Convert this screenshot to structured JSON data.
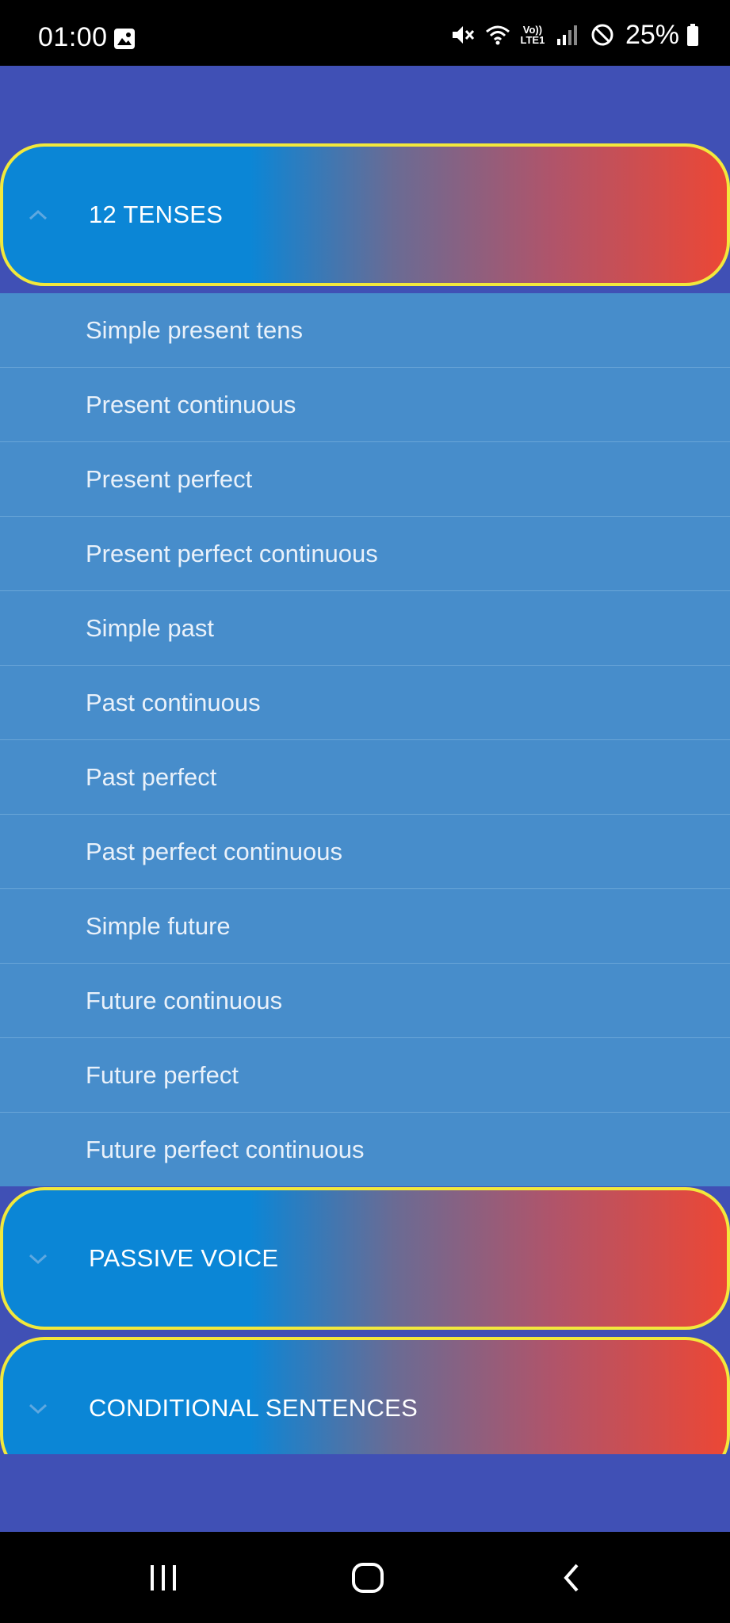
{
  "status_bar": {
    "time": "01:00",
    "volte_line1": "Vo))",
    "volte_line2": "LTE1",
    "battery": "25%"
  },
  "accordion": {
    "groups": [
      {
        "title": "12 TENSES",
        "expanded": true,
        "items": [
          "Simple present tens",
          "Present continuous",
          "Present perfect",
          "Present perfect continuous",
          "Simple past",
          "Past continuous",
          "Past perfect",
          "Past perfect continuous",
          "Simple future",
          "Future continuous",
          "Future perfect",
          "Future perfect continuous"
        ]
      },
      {
        "title": "PASSIVE VOICE",
        "expanded": false
      },
      {
        "title": "CONDITIONAL SENTENCES",
        "expanded": false
      }
    ]
  },
  "colors": {
    "background": "#4050b5",
    "header_border": "#f2e83c",
    "gradient_start": "#0b86d6",
    "gradient_end": "#ec4735",
    "sub_item_bg": "#478dcb"
  },
  "icons": {
    "status": [
      "image-icon",
      "mute-icon",
      "wifi-icon",
      "signal-icon",
      "do-not-disturb-icon",
      "battery-icon"
    ],
    "nav": [
      "recent-apps-icon",
      "home-icon",
      "back-icon"
    ]
  }
}
